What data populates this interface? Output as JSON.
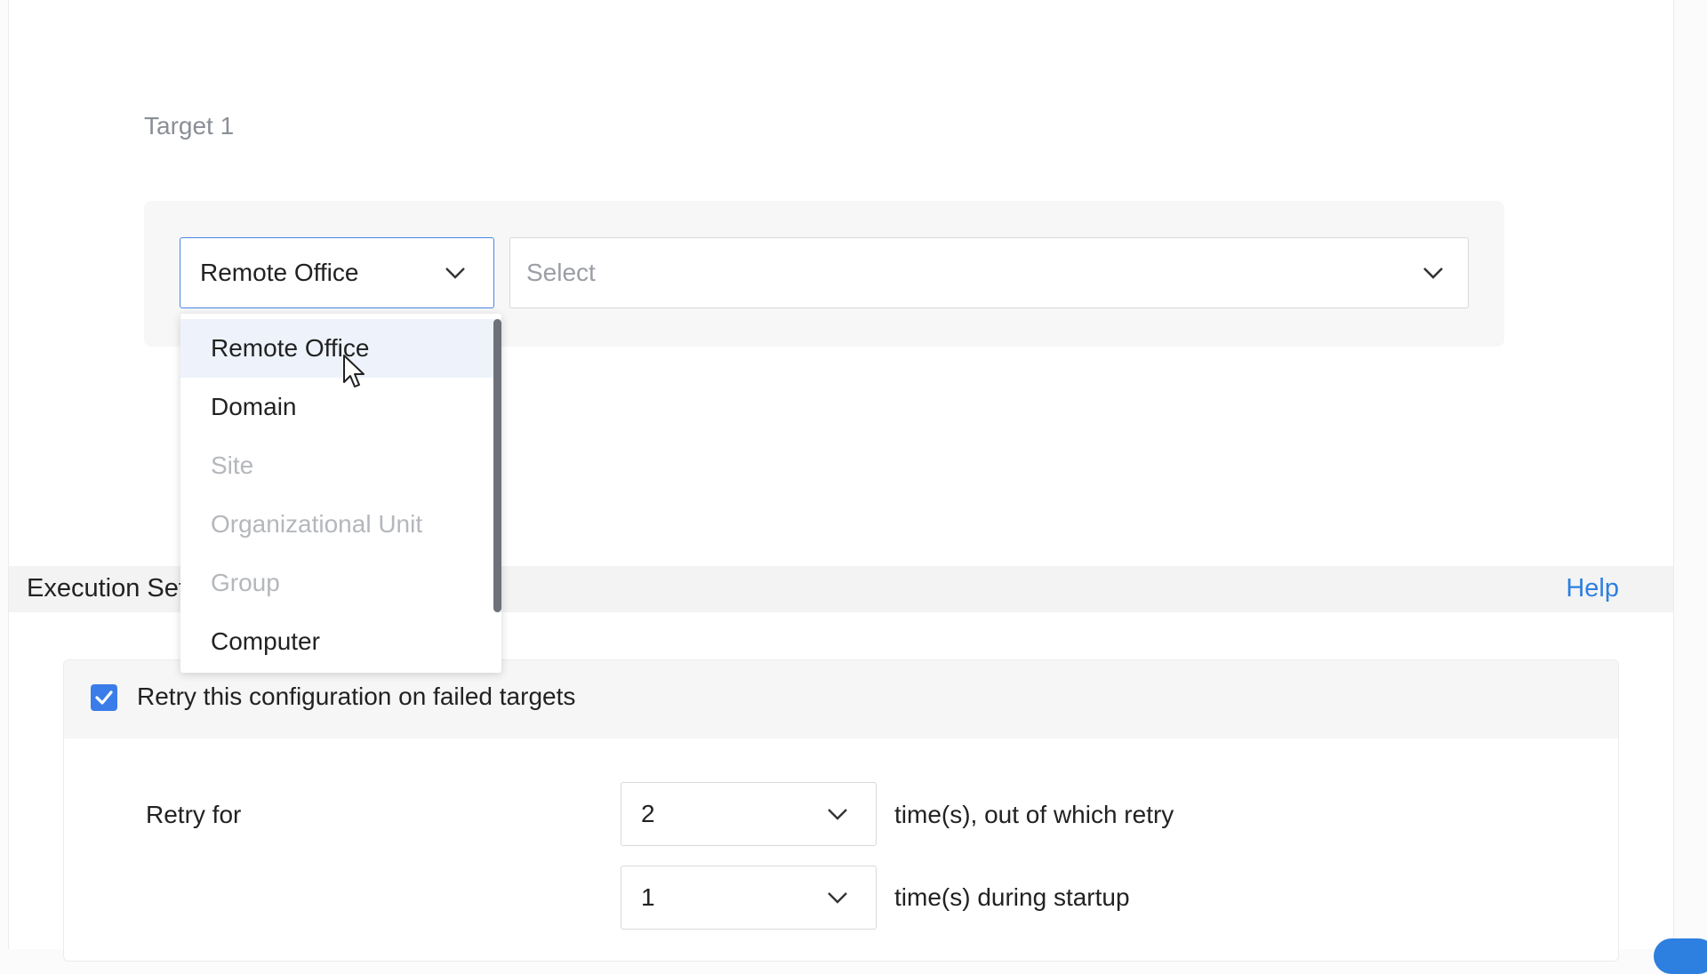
{
  "target": {
    "label": "Target 1",
    "type_select_value": "Remote Office",
    "value_select_placeholder": "Select"
  },
  "dropdown": {
    "items": [
      {
        "label": "Remote Office",
        "state": "hover"
      },
      {
        "label": "Domain",
        "state": "enabled"
      },
      {
        "label": "Site",
        "state": "disabled"
      },
      {
        "label": "Organizational Unit",
        "state": "disabled"
      },
      {
        "label": "Group",
        "state": "disabled"
      },
      {
        "label": "Computer",
        "state": "enabled"
      }
    ]
  },
  "execution": {
    "section_title": "Execution Settings",
    "help_link": "Help",
    "retry_checkbox_label": "Retry this configuration on failed targets",
    "retry_checked": true,
    "retry_for_label": "Retry for",
    "retry_count_value": "2",
    "retry_count_suffix": "time(s), out of which retry",
    "startup_count_value": "1",
    "startup_count_suffix": "time(s) during startup"
  },
  "colors": {
    "accent": "#3b7de8",
    "link": "#2d7fe0",
    "disabled_text": "#b4b7bc",
    "hover_bg": "#eef3fb"
  },
  "icons": {
    "select_chevron": "chevron-down-icon",
    "checkbox_check": "checkmark-icon",
    "cursor": "mouse-pointer-icon"
  }
}
